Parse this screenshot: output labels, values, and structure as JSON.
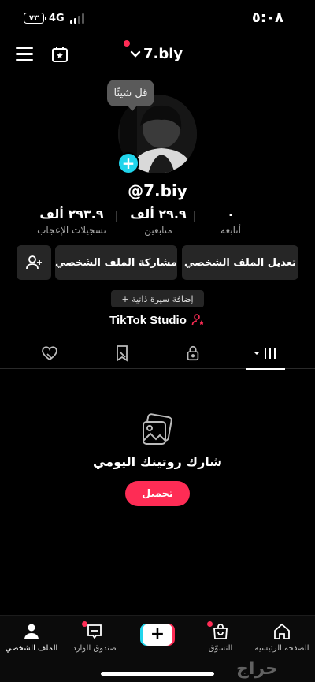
{
  "status_bar": {
    "time": "٥:٠٨",
    "battery_level": "٧٣",
    "network": "4G"
  },
  "header": {
    "account_name": "7.biy"
  },
  "profile": {
    "bubble_text": "قل شيئًا",
    "username": "@7.biy",
    "stats": {
      "likes": {
        "value": "٢٩٣.٩ ألف",
        "label": "تسجيلات الإعجاب"
      },
      "followers": {
        "value": "٢٩.٩ ألف",
        "label": "متابعين"
      },
      "following": {
        "value": "٠",
        "label": "أتابعه"
      }
    },
    "buttons": {
      "edit": "تعديل الملف الشخصي",
      "share": "مشاركة الملف الشخصي"
    },
    "add_bio": "+ إضافة سيرة ذاتية",
    "studio": "TikTok Studio"
  },
  "empty_state": {
    "title": "شارك روتينك اليومي",
    "upload": "تحميل"
  },
  "bottom_nav": {
    "home": "الصفحة الرئيسية",
    "shop": "التسوّق",
    "inbox": "صندوق الوارد",
    "profile": "الملف الشخصي"
  },
  "watermark": "حراج",
  "colors": {
    "accent": "#fe2c55",
    "cyan": "#20d5ec",
    "background": "#000000"
  }
}
